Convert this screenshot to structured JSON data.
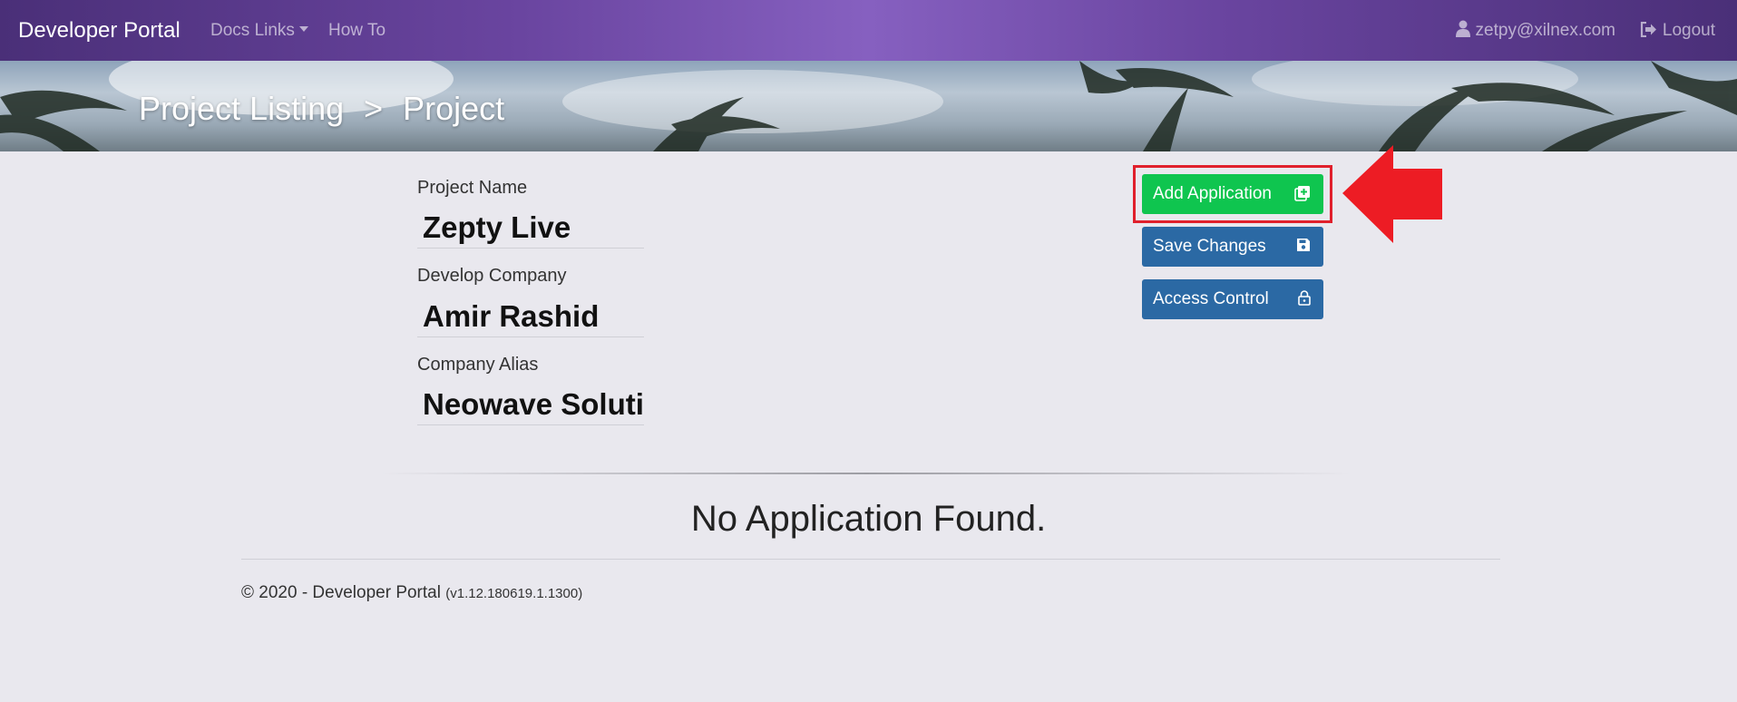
{
  "navbar": {
    "brand": "Developer Portal",
    "docs_links": "Docs Links",
    "how_to": "How To",
    "user_email": "zetpy@xilnex.com",
    "logout": "Logout"
  },
  "breadcrumb": {
    "parent": "Project Listing",
    "separator": ">",
    "current": "Project"
  },
  "form": {
    "project_name_label": "Project Name",
    "project_name_value": "Zepty Live",
    "develop_company_label": "Develop Company",
    "develop_company_value": "Amir Rashid",
    "company_alias_label": "Company Alias",
    "company_alias_value": "Neowave Solutions"
  },
  "actions": {
    "add_application": "Add Application",
    "save_changes": "Save Changes",
    "access_control": "Access Control"
  },
  "main": {
    "empty_message": "No Application Found."
  },
  "footer": {
    "copyright": "© 2020 - Developer Portal",
    "version": "(v1.12.180619.1.1300)"
  },
  "colors": {
    "navbar_purple": "#6a45a0",
    "add_button_green": "#0fc54f",
    "action_button_blue": "#2b69a4",
    "highlight_red": "#e0202c"
  }
}
